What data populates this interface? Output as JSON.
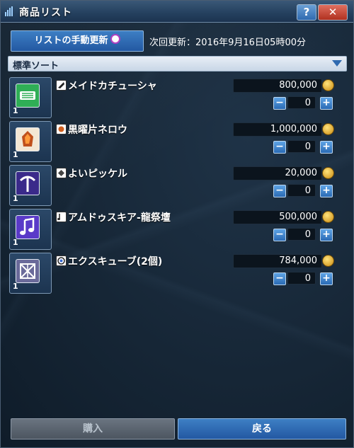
{
  "window": {
    "title": "商品リスト",
    "help_label": "?",
    "close_label": "✕"
  },
  "refresh": {
    "button_label": "リストの手動更新",
    "last_update": "次回更新：2016年9月16日05時00分"
  },
  "sort": {
    "label": "標準ソート"
  },
  "items": [
    {
      "name": "メイドカチューシャ",
      "price": "800,000",
      "quantity": "0",
      "badge": "1",
      "icon_name": "headband-icon",
      "type_icon": "accessory-icon",
      "thumb_color": "#2fae56"
    },
    {
      "name": "黒曜片ネロウ",
      "price": "1,000,000",
      "quantity": "0",
      "badge": "1",
      "icon_name": "fire-crystal-icon",
      "type_icon": "material-icon",
      "thumb_color": "#c0501c"
    },
    {
      "name": "よいピッケル",
      "price": "20,000",
      "quantity": "0",
      "badge": "1",
      "icon_name": "pickaxe-icon",
      "type_icon": "tool-icon",
      "thumb_color": "#3a2a8a"
    },
    {
      "name": "アムドゥスキア-龍祭壇",
      "price": "500,000",
      "quantity": "0",
      "badge": "1",
      "icon_name": "music-note-icon",
      "type_icon": "music-icon",
      "thumb_color": "#5a3ac8"
    },
    {
      "name": "エクスキューブ(2個)",
      "price": "784,000",
      "quantity": "0",
      "badge": "1",
      "icon_name": "ex-cube-icon",
      "type_icon": "cube-icon",
      "thumb_color": "#6a6a9a"
    }
  ],
  "footer": {
    "buy_label": "購入",
    "back_label": "戻る"
  }
}
